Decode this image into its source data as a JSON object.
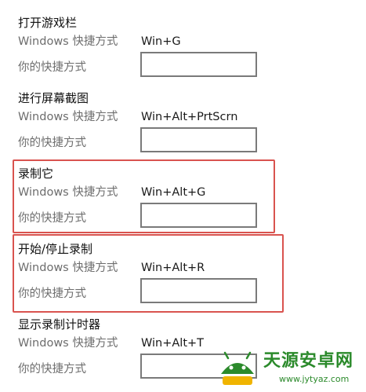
{
  "groups": [
    {
      "title": "打开游戏栏",
      "default_label": "Windows 快捷方式",
      "default_value": "Win+G",
      "yours_label": "你的快捷方式",
      "yours_value": ""
    },
    {
      "title": "进行屏幕截图",
      "default_label": "Windows 快捷方式",
      "default_value": "Win+Alt+PrtScrn",
      "yours_label": "你的快捷方式",
      "yours_value": ""
    },
    {
      "title": "录制它",
      "default_label": "Windows 快捷方式",
      "default_value": "Win+Alt+G",
      "yours_label": "你的快捷方式",
      "yours_value": ""
    },
    {
      "title": "开始/停止录制",
      "default_label": "Windows 快捷方式",
      "default_value": "Win+Alt+R",
      "yours_label": "你的快捷方式",
      "yours_value": ""
    },
    {
      "title": "显示录制计时器",
      "default_label": "Windows 快捷方式",
      "default_value": "Win+Alt+T",
      "yours_label": "你的快捷方式",
      "yours_value": ""
    }
  ],
  "watermark": {
    "name": "天源安卓网",
    "url": "www.jytyaz.com"
  },
  "colors": {
    "highlight": "#d9534f",
    "watermark": "#2b8a2b"
  }
}
